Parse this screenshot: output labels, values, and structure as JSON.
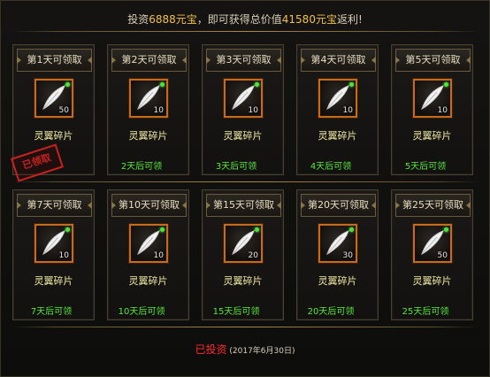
{
  "header": {
    "prefix": "投资",
    "invest_amount": "6888元宝",
    "middle": "，即可获得总价值",
    "total_value": "41580元宝",
    "suffix": "返利!"
  },
  "cards_row1": [
    {
      "title": "第1天可领取",
      "qty": "50",
      "name": "灵翼碎片",
      "status_text": ""
    },
    {
      "title": "第2天可领取",
      "qty": "10",
      "name": "灵翼碎片",
      "status_text": "2天后可领"
    },
    {
      "title": "第3天可领取",
      "qty": "10",
      "name": "灵翼碎片",
      "status_text": "3天后可领"
    },
    {
      "title": "第4天可领取",
      "qty": "10",
      "name": "灵翼碎片",
      "status_text": "4天后可领"
    },
    {
      "title": "第5天可领取",
      "qty": "10",
      "name": "灵翼碎片",
      "status_text": "5天后可领"
    }
  ],
  "cards_row2": [
    {
      "title": "第7天可领取",
      "qty": "10",
      "name": "灵翼碎片",
      "status_text": "7天后可领"
    },
    {
      "title": "第10天可领取",
      "qty": "10",
      "name": "灵翼碎片",
      "status_text": "10天后可领"
    },
    {
      "title": "第15天可领取",
      "qty": "20",
      "name": "灵翼碎片",
      "status_text": "15天后可领"
    },
    {
      "title": "第20天可领取",
      "qty": "30",
      "name": "灵翼碎片",
      "status_text": "20天后可领"
    },
    {
      "title": "第25天可领取",
      "qty": "50",
      "name": "灵翼碎片",
      "status_text": "25天后可领"
    }
  ],
  "claimed_stamp": "已领取",
  "footer": {
    "status": "已投资",
    "date": "(2017年6月30日)"
  }
}
